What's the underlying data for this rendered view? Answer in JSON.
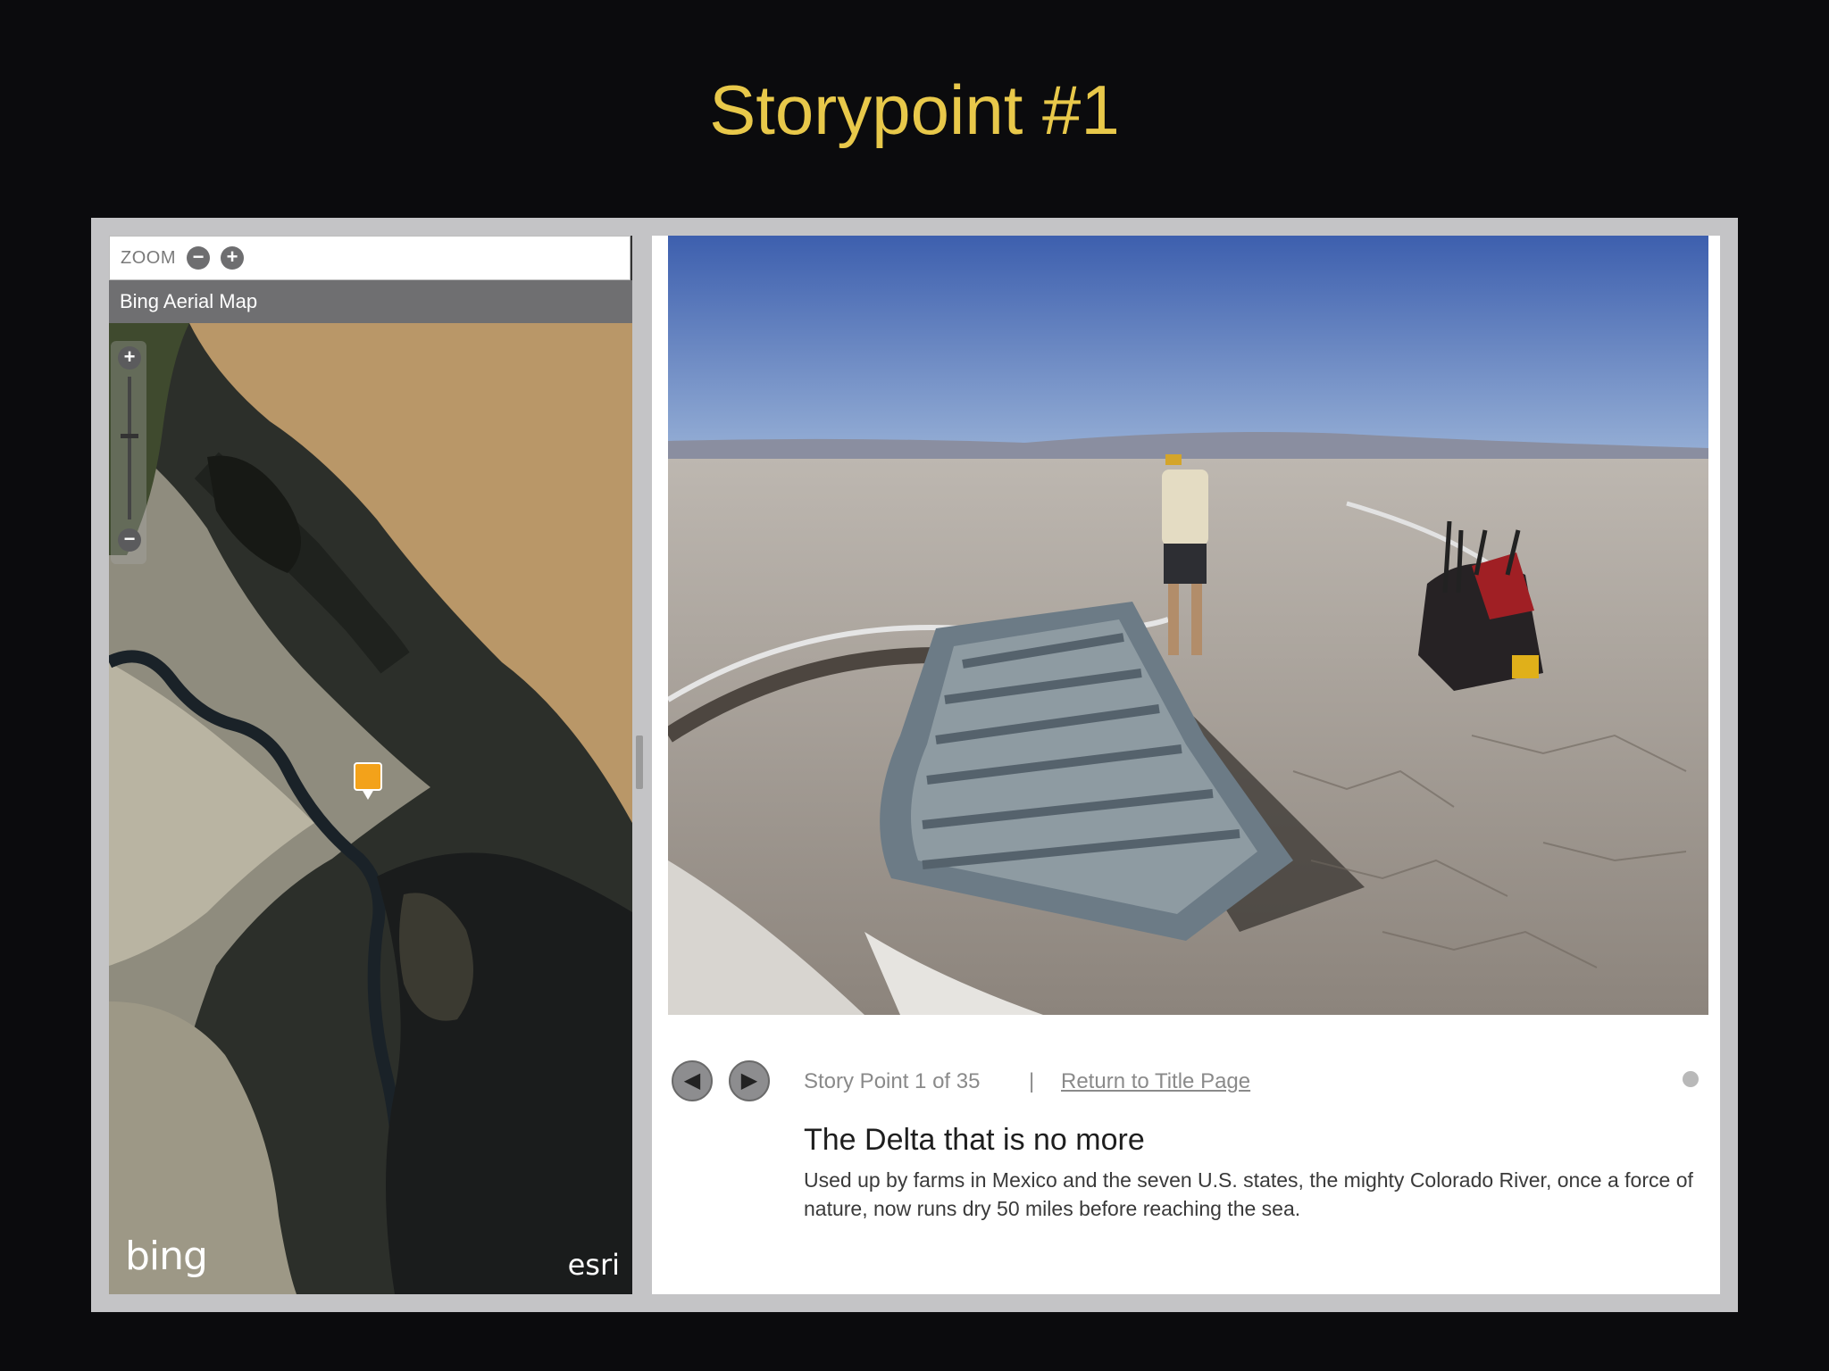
{
  "slide": {
    "title": "Storypoint #1"
  },
  "map": {
    "zoom_label": "ZOOM",
    "zoom_out_glyph": "−",
    "zoom_in_glyph": "+",
    "header": "Bing Aerial Map",
    "nav_in_glyph": "+",
    "nav_out_glyph": "−",
    "bing_logo": "bing",
    "esri_logo": "esri",
    "marker_icon": "camera-marker-icon"
  },
  "story": {
    "prev_glyph": "◀",
    "next_glyph": "▶",
    "counter": "Story Point 1 of 35",
    "separator": "|",
    "return_link": "Return to Title Page",
    "title": "The Delta that is no more",
    "body": "Used up by farms in Mexico and the seven U.S. states, the mighty Colorado River, once a force of nature, now runs dry 50 miles before reaching the sea."
  },
  "colors": {
    "title": "#e8c84a",
    "background": "#0b0b0d",
    "marker": "#f3a21a"
  }
}
